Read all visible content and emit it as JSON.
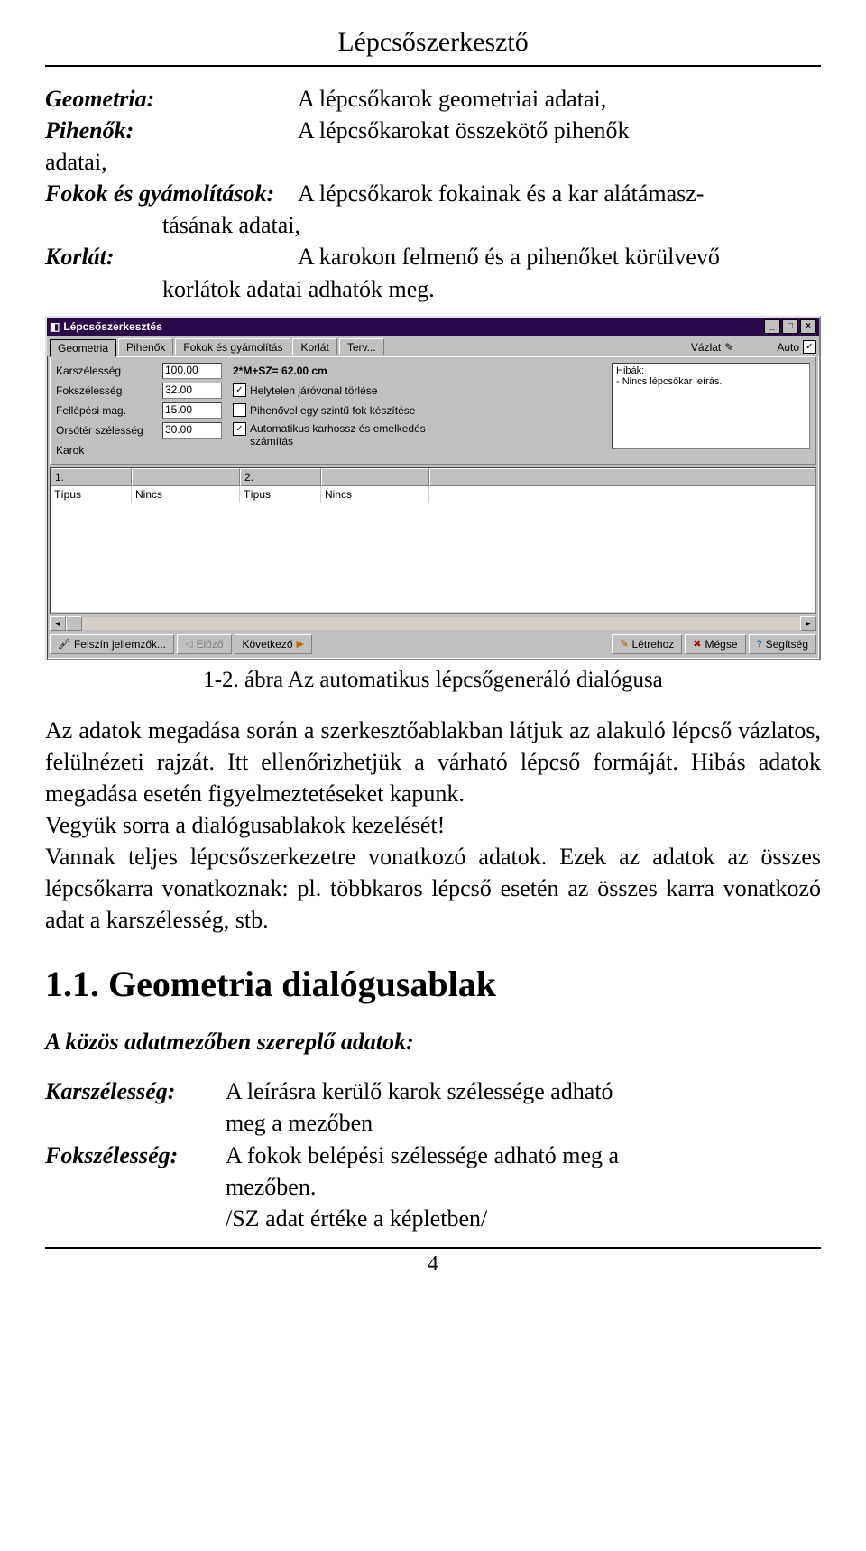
{
  "page_title": "Lépcsőszerkesztő",
  "defs": {
    "geometria_term": "Geometria:",
    "geometria_val": "A lépcsőkarok geometriai adatai,",
    "pihenok_term": "Pihenők:",
    "pihenok_val": "A lépcsőkarokat összekötő pihenők",
    "adatai_cont": "adatai,",
    "fokok_term": "Fokok és gyámolítások:",
    "fokok_val": "A lépcsőkarok fokainak és a kar alátámasz-",
    "fokok_cont": "tásának adatai,",
    "korlat_term": "Korlát:",
    "korlat_val": "A karokon felmenő és a pihenőket körülvevő",
    "korlat_cont": "korlátok adatai adhatók meg."
  },
  "win": {
    "title": "Lépcsőszerkesztés",
    "minimize": "_",
    "maximize": "□",
    "close": "×",
    "tabs": [
      "Geometria",
      "Pihenők",
      "Fokok és gyámolítás",
      "Korlát",
      "Terv..."
    ],
    "vazlat_label": "Vázlat",
    "auto_label": "Auto",
    "fields": {
      "karszelesseg": {
        "label": "Karszélesség",
        "value": "100.00"
      },
      "fokszelesseg": {
        "label": "Fokszélesség",
        "value": "32.00"
      },
      "fellepesi": {
        "label": "Fellépési mag.",
        "value": "15.00"
      },
      "orsoter": {
        "label": "Orsótér szélesség",
        "value": "30.00"
      },
      "karok": {
        "label": "Karok"
      }
    },
    "formula": "2*M+SZ= 62.00 cm",
    "chk1": "Helytelen járóvonal törlése",
    "chk2": "Pihenővel egy szintű fok készítése",
    "chk3": "Automatikus karhossz és emelkedés számítás",
    "hibak_label": "Hibák:",
    "hiba_item": "- Nincs lépcsőkar leírás.",
    "grid": {
      "col1_num": "1.",
      "col2_num": "2.",
      "header": "Típus",
      "nincs": "Nincs"
    },
    "buttons": {
      "felszin": "Felszín jellemzők...",
      "elozo": "Előző",
      "kovetkezo": "Következő",
      "letrehoz": "Létrehoz",
      "megse": "Mégse",
      "segitseg": "Segítség"
    }
  },
  "caption": "1-2. ábra Az automatikus lépcsőgeneráló dialógusa",
  "para1": "Az adatok megadása során a szerkesztőablakban látjuk az alakuló lépcső vázlatos, felülnézeti rajzát. Itt ellenőrizhetjük a várható lépcső formáját. Hibás adatok megadása esetén figyelmeztetéseket kapunk.",
  "para2": "Vegyük sorra a dialógusablakok kezelését!",
  "para3": "Vannak teljes lépcsőszerkezetre vonatkozó adatok. Ezek az adatok az összes lépcsőkarra vonatkoznak: pl. többkaros lépcső esetén az összes karra vonatkozó adat a karszélesség, stb.",
  "section_heading": "1.1. Geometria dialógusablak",
  "subheading": "A közös adatmezőben szereplő adatok:",
  "defs2": {
    "kar_term": "Karszélesség:",
    "kar_val": "A leírásra kerülő karok szélessége adható",
    "kar_cont": "meg a mezőben",
    "fok_term": "Fokszélesség:",
    "fok_val": "A fokok belépési szélessége adható meg a",
    "fok_cont": "mezőben.",
    "sz_note": "/SZ adat értéke a képletben/"
  },
  "page_number": "4"
}
